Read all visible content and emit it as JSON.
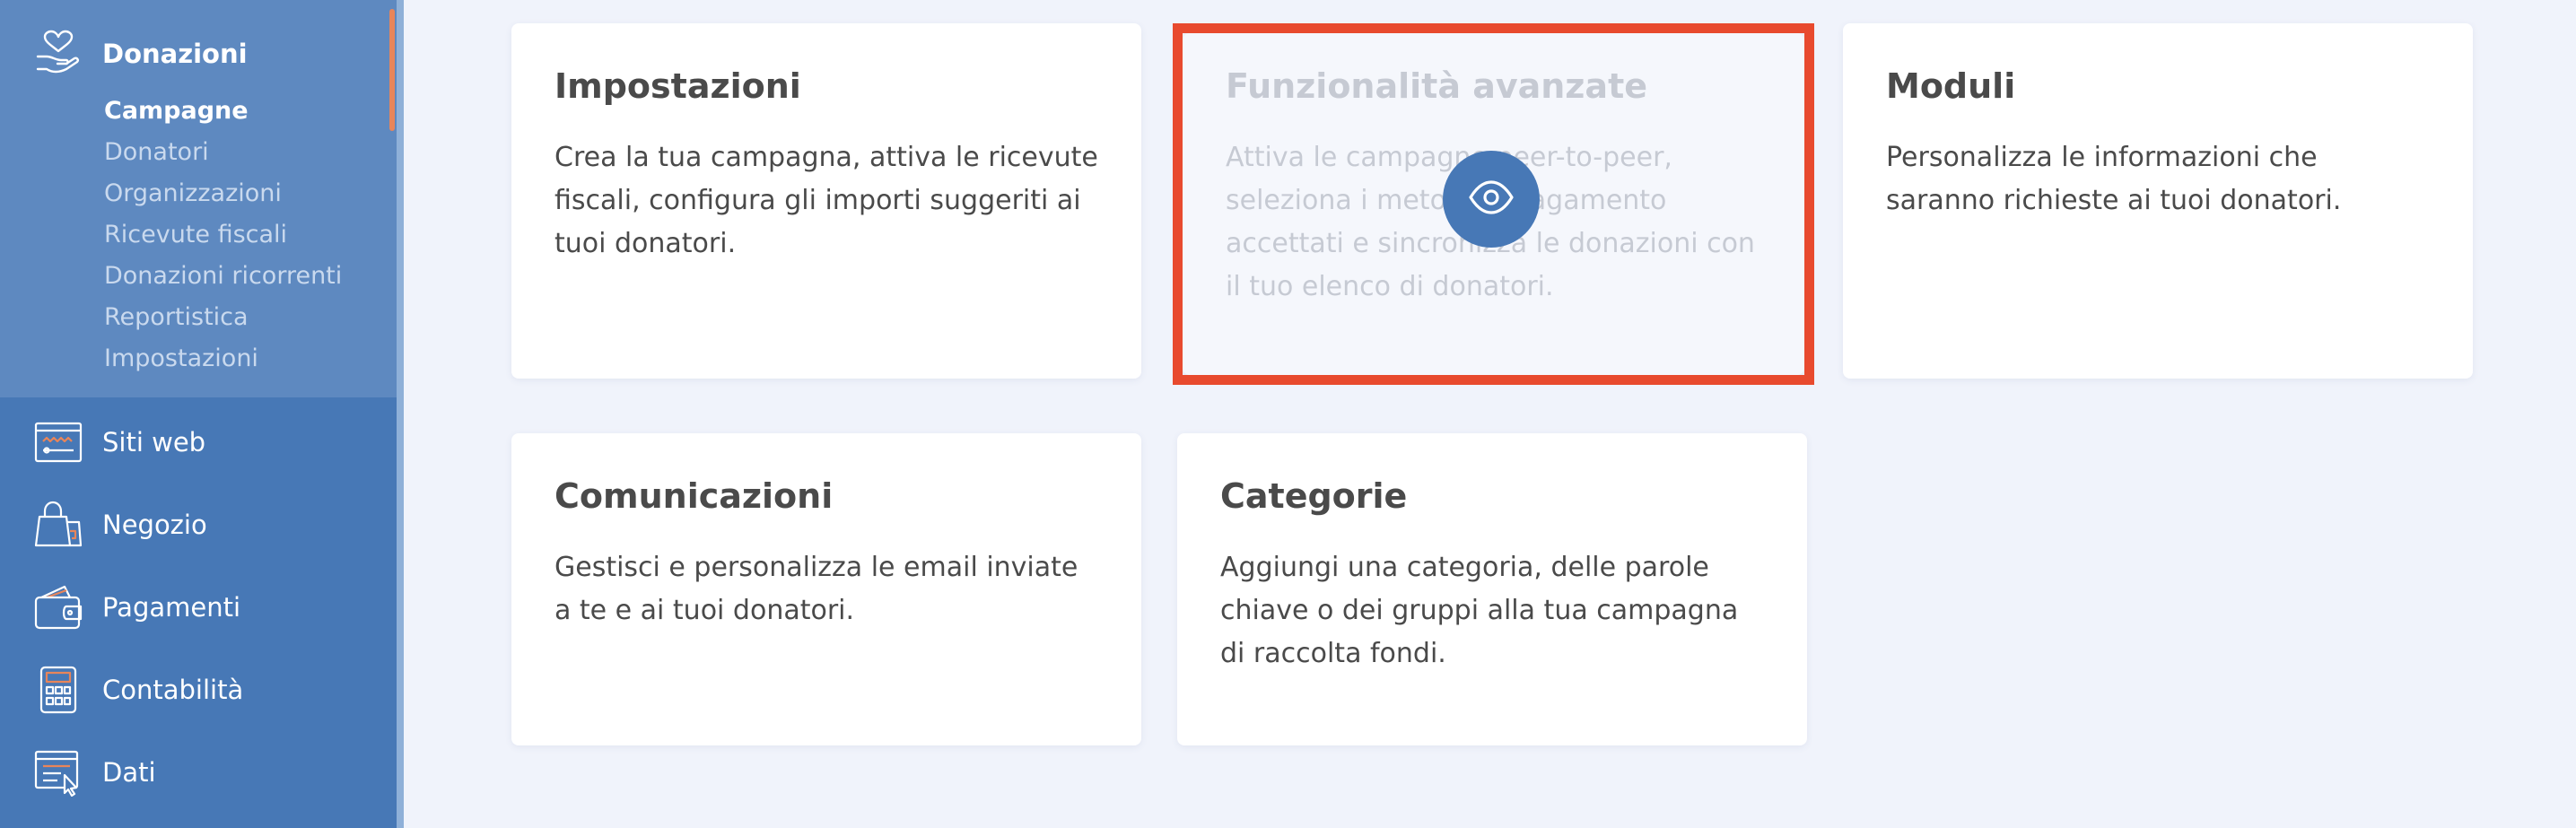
{
  "sidebar": {
    "donazioni": {
      "label": "Donazioni",
      "subitems": [
        {
          "label": "Campagne",
          "active": true
        },
        {
          "label": "Donatori",
          "active": false
        },
        {
          "label": "Organizzazioni",
          "active": false
        },
        {
          "label": "Ricevute fiscali",
          "active": false
        },
        {
          "label": "Donazioni ricorrenti",
          "active": false
        },
        {
          "label": "Reportistica",
          "active": false
        },
        {
          "label": "Impostazioni",
          "active": false
        }
      ]
    },
    "items": [
      {
        "label": "Siti web",
        "icon": "website-icon"
      },
      {
        "label": "Negozio",
        "icon": "shopping-bag-icon"
      },
      {
        "label": "Pagamenti",
        "icon": "wallet-icon"
      },
      {
        "label": "Contabilità",
        "icon": "calculator-icon"
      },
      {
        "label": "Dati",
        "icon": "data-icon"
      }
    ]
  },
  "cards": [
    {
      "title": "Impostazioni",
      "description": "Crea la tua campagna, attiva le ricevute fiscali, configura gli importi suggeriti ai tuoi donatori."
    },
    {
      "title": "Funzionalità avanzate",
      "description": "Attiva le campagne peer-to-peer, seleziona i metodi di pagamento accettati e sincronizza le donazioni con il tuo elenco di donatori.",
      "disabled": true
    },
    {
      "title": "Moduli",
      "description": "Personalizza le informazioni che saranno richieste ai tuoi donatori."
    },
    {
      "title": "Comunicazioni",
      "description": "Gestisci e personalizza le email inviate a te e ai tuoi donatori."
    },
    {
      "title": "Categorie",
      "description": "Aggiungi una categoria, delle parole chiave o dei gruppi alla tua campagna di raccolta fondi."
    }
  ],
  "colors": {
    "sidebar": "#4778b6",
    "sidebar_active_section": "#5e89c0",
    "accent": "#e8855a",
    "highlight": "#e84a2e",
    "background": "#f0f3fb"
  }
}
